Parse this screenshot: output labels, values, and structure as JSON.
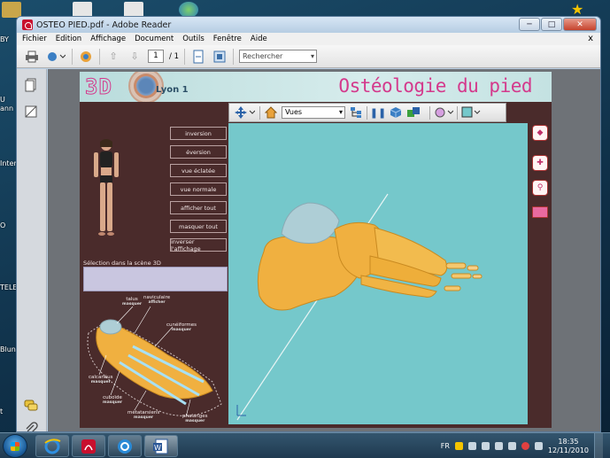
{
  "desktop": {
    "labels": [
      "BY",
      "U",
      "ann",
      "Inter",
      "O",
      "TELE",
      "Blun",
      "t"
    ]
  },
  "window": {
    "title": "OSTEO PIED.pdf - Adobe Reader",
    "controls": {
      "minimize": "─",
      "maximize": "□",
      "close": "✕"
    }
  },
  "menu": {
    "items": [
      "Fichier",
      "Edition",
      "Affichage",
      "Document",
      "Outils",
      "Fenêtre",
      "Aide"
    ],
    "close": "x"
  },
  "toolbar": {
    "page_current": "1",
    "page_total": "/ 1",
    "search_placeholder": "Rechercher"
  },
  "page": {
    "logo_3d": "3D",
    "logo_city": "Lyon 1",
    "title": "Ostéologie du pied"
  },
  "viewer": {
    "views_select": "Vues"
  },
  "actions": [
    "inversion",
    "éversion",
    "vue éclatée",
    "vue normale",
    "afficher tout",
    "masquer tout",
    "inverser l'affichage"
  ],
  "selection_label": "Sélection dans la scène 3D",
  "bones": [
    {
      "name": "talus",
      "state": "masquer"
    },
    {
      "name": "naviculaire",
      "state": "afficher"
    },
    {
      "name": "cunéiformes",
      "state": "masquer"
    },
    {
      "name": "calcanéus",
      "state": "masquer"
    },
    {
      "name": "cuboïde",
      "state": "masquer"
    },
    {
      "name": "métatarsiens",
      "state": "masquer"
    },
    {
      "name": "phalanges",
      "state": "masquer"
    }
  ],
  "taskbar": {
    "language": "FR",
    "time": "18:35",
    "date": "12/11/2010"
  },
  "colors": {
    "accent_pink": "#d4398c",
    "bone": "#f0b040",
    "viewport": "#75c8cb",
    "page_bg": "#4a2b2b"
  }
}
